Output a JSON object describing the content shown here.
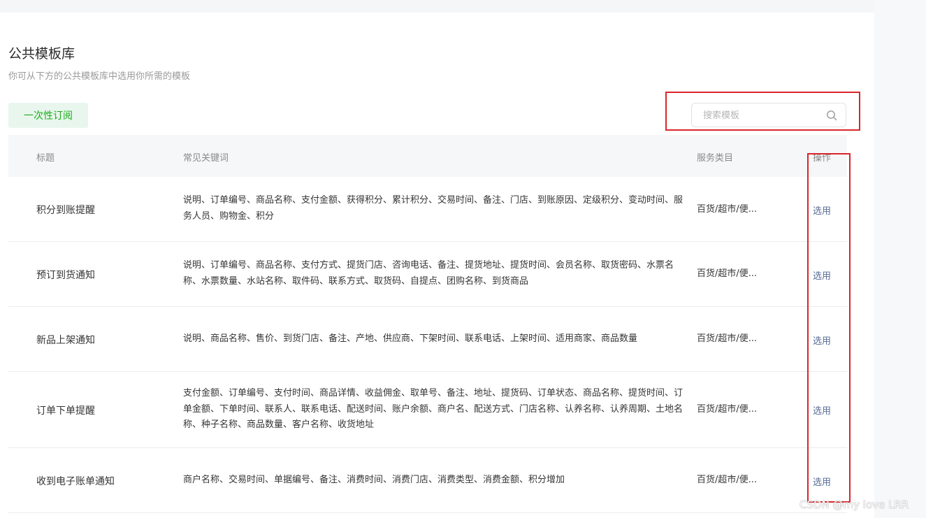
{
  "page": {
    "title": "公共模板库",
    "subtitle": "你可从下方的公共模板库中选用你所需的模板"
  },
  "toolbar": {
    "subscribe_label": "一次性订阅"
  },
  "search": {
    "placeholder": "搜索模板",
    "value": ""
  },
  "table": {
    "headers": {
      "title": "标题",
      "keywords": "常见关键词",
      "category": "服务类目",
      "action": "操作"
    },
    "rows": [
      {
        "title": "积分到账提醒",
        "keywords": "说明、订单编号、商品名称、支付金额、获得积分、累计积分、交易时间、备注、门店、到账原因、定级积分、变动时间、服务人员、购物金、积分",
        "category": "百货/超市/便...",
        "action": "选用"
      },
      {
        "title": "预订到货通知",
        "keywords": "说明、订单编号、商品名称、支付方式、提货门店、咨询电话、备注、提货地址、提货时间、会员名称、取货密码、水票名称、水票数量、水站名称、取件码、联系方式、取货码、自提点、团购名称、到货商品",
        "category": "百货/超市/便...",
        "action": "选用"
      },
      {
        "title": "新品上架通知",
        "keywords": "说明、商品名称、售价、到货门店、备注、产地、供应商、下架时间、联系电话、上架时间、适用商家、商品数量",
        "category": "百货/超市/便...",
        "action": "选用"
      },
      {
        "title": "订单下单提醒",
        "keywords": "支付金额、订单编号、支付时间、商品详情、收益佣金、取单号、备注、地址、提货码、订单状态、商品名称、提货时间、订单金额、下单时间、联系人、联系电话、配送时间、账户余额、商户名、配送方式、门店名称、认养名称、认养周期、土地名称、种子名称、商品数量、客户名称、收货地址",
        "category": "百货/超市/便...",
        "action": "选用"
      },
      {
        "title": "收到电子账单通知",
        "keywords": "商户名称、交易时间、单据编号、备注、消费时间、消费门店、消费类型、消费金额、积分增加",
        "category": "百货/超市/便...",
        "action": "选用"
      }
    ]
  },
  "watermark": "CSDN @my love  LRR",
  "colors": {
    "accent_green": "#1aad19",
    "link_blue": "#576b95",
    "highlight_red": "#d9262c"
  }
}
